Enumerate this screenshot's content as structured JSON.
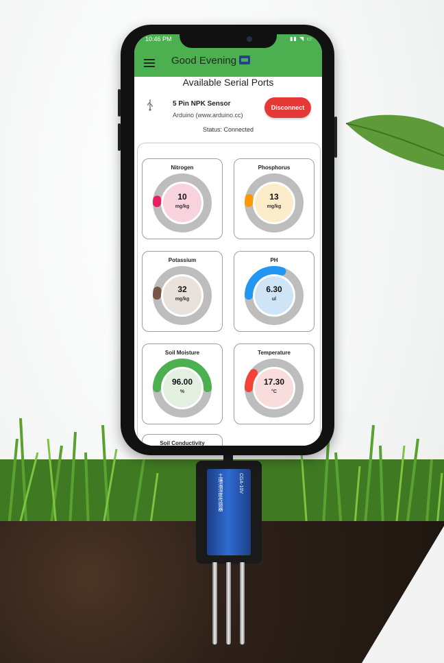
{
  "status_bar": {
    "time": "10:46 PM",
    "icons": "▮▮ ◥ ▭"
  },
  "app_bar": {
    "greeting": "Good Evening"
  },
  "serial_ports": {
    "title": "Available Serial Ports",
    "device_name": "5 Pin NPK Sensor",
    "device_vendor": "Arduino (www.arduino.cc)",
    "disconnect_label": "Disconnect",
    "status": "Status: Connected"
  },
  "sensors": [
    {
      "title": "Nitrogen",
      "value": "10",
      "unit": "mg/kg",
      "fraction": 0.02,
      "color": "#e91e63",
      "center_color": "#f8d3de"
    },
    {
      "title": "Phosphorus",
      "value": "13",
      "unit": "mg/kg",
      "fraction": 0.03,
      "color": "#ff9800",
      "center_color": "#fdecc9"
    },
    {
      "title": "Potassium",
      "value": "32",
      "unit": "mg/kg",
      "fraction": 0.03,
      "color": "#795548",
      "center_color": "#e9e1dc"
    },
    {
      "title": "PH",
      "value": "6.30",
      "unit": "ul",
      "fraction": 0.3,
      "color": "#2196f3",
      "center_color": "#cfe4f7"
    },
    {
      "title": "Soil Moisture",
      "value": "96.00",
      "unit": "%",
      "fraction": 0.5,
      "color": "#4caf50",
      "center_color": "#e3f0e0"
    },
    {
      "title": "Temperature",
      "value": "17.30",
      "unit": "°C",
      "fraction": 0.1,
      "color": "#f44336",
      "center_color": "#f9dcdc"
    }
  ],
  "partial_card": {
    "title": "Soil Conductivity"
  },
  "probe": {
    "label": "土壤温湿度传感器",
    "model": "CGA-10V"
  },
  "colors": {
    "app_bar": "#4caf50",
    "disconnect": "#e53935",
    "track": "#bdbdbd"
  }
}
